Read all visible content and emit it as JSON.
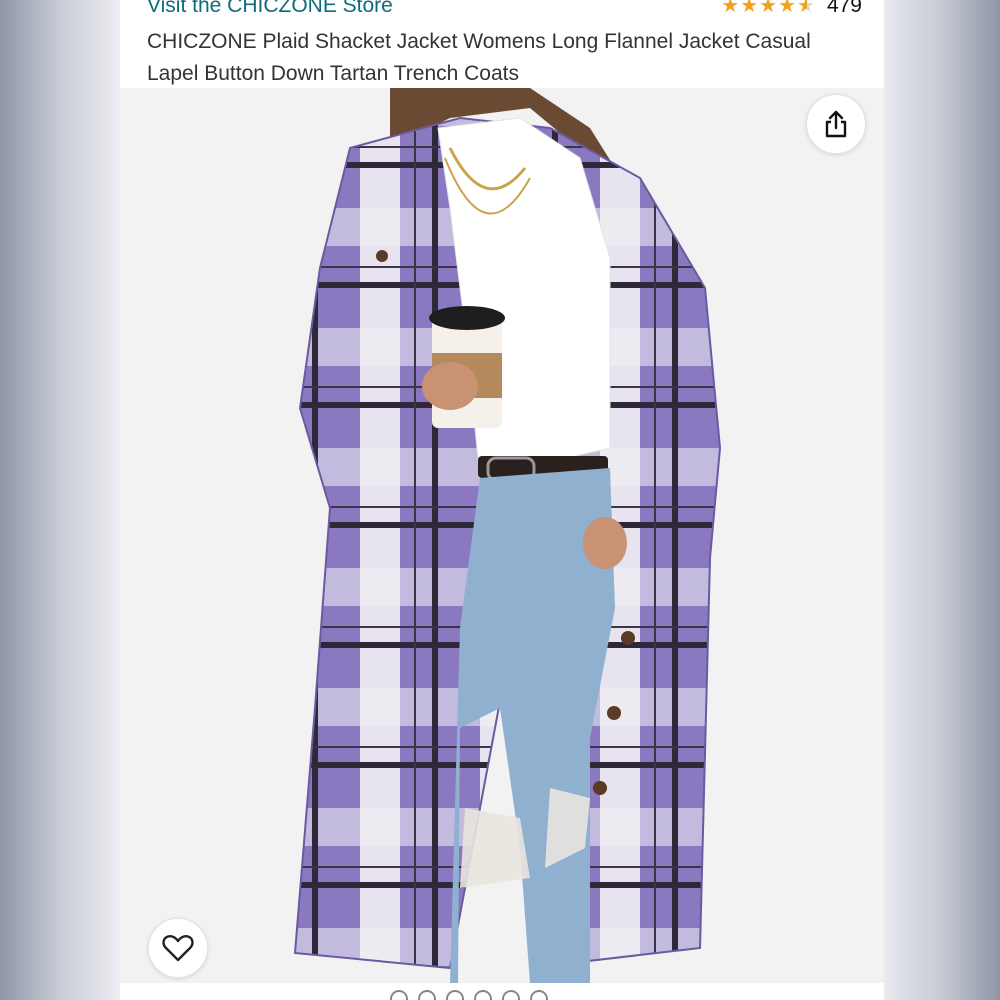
{
  "store": {
    "link_text": "Visit the CHICZONE Store"
  },
  "rating": {
    "stars": 4.5,
    "count": "479",
    "star_color": "#f0a31a"
  },
  "product": {
    "title": "CHICZONE Plaid Shacket Jacket Womens Long Flannel Jacket Casual Lapel Button Down Tartan Trench Coats"
  },
  "image": {
    "coat_colors": {
      "purple": "#8a79c0",
      "white": "#f2f0f4",
      "dark": "#2e2838"
    },
    "shirt_color": "#ffffff",
    "jeans_color": "#8fb0cf"
  },
  "icons": {
    "share": "share-icon",
    "favorite": "heart-icon"
  },
  "gallery": {
    "dot_count": 6
  }
}
